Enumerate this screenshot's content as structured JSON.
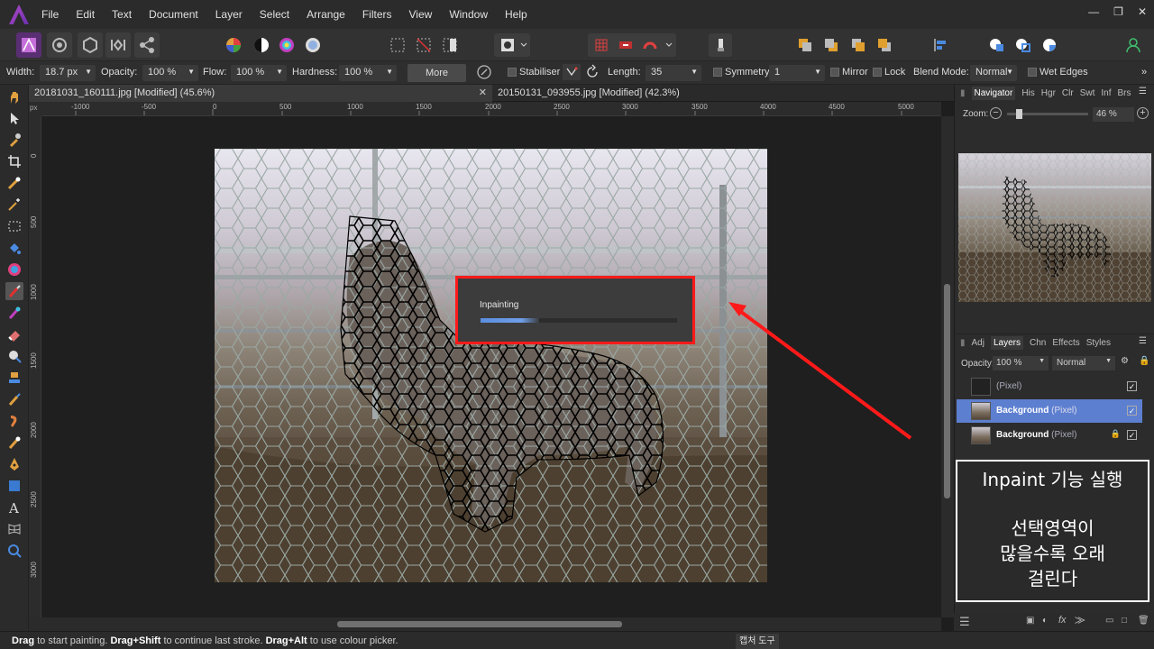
{
  "menu": [
    "File",
    "Edit",
    "Text",
    "Document",
    "Layer",
    "Select",
    "Arrange",
    "Filters",
    "View",
    "Window",
    "Help"
  ],
  "context_bar": {
    "width_label": "Width:",
    "width_value": "18.7 px",
    "opacity_label": "Opacity:",
    "opacity_value": "100 %",
    "flow_label": "Flow:",
    "flow_value": "100 %",
    "hardness_label": "Hardness:",
    "hardness_value": "100 %",
    "more_label": "More",
    "stabiliser_label": "Stabiliser",
    "length_label": "Length:",
    "length_value": "35",
    "symmetry_label": "Symmetry",
    "symmetry_value": "1",
    "mirror_label": "Mirror",
    "lock_label": "Lock",
    "blend_label": "Blend Mode:",
    "blend_value": "Normal",
    "wet_edges_label": "Wet Edges"
  },
  "tabs": [
    {
      "title": "20181031_160111.jpg [Modified] (45.6%)"
    },
    {
      "title": "20150131_093955.jpg [Modified] (42.3%)"
    }
  ],
  "ruler": {
    "unit": "px",
    "h_labels": [
      "-1000",
      "-500",
      "0",
      "500",
      "1000",
      "1500",
      "2000",
      "2500",
      "3000",
      "3500",
      "4000",
      "4500",
      "5000"
    ],
    "v_labels": [
      "0",
      "500",
      "1000",
      "1500",
      "2000",
      "2500",
      "3000"
    ]
  },
  "dialog": {
    "title": "Inpainting",
    "progress": 0.3
  },
  "status": {
    "drag": "Drag",
    "drag_text": " to start painting. ",
    "drag_shift": "Drag+Shift",
    "drag_shift_text": " to continue last stroke. ",
    "drag_alt": "Drag+Alt",
    "drag_alt_text": " to use colour picker.",
    "capture_label": "캡처 도구"
  },
  "navigator": {
    "tabs": [
      "Navigator",
      "His",
      "Hgr",
      "Clr",
      "Swt",
      "Inf",
      "Brs"
    ],
    "zoom_label": "Zoom:",
    "zoom_value": "46 %"
  },
  "layers_panel": {
    "tabs": [
      "Adj",
      "Layers",
      "Chn",
      "Effects",
      "Styles"
    ],
    "opacity_label": "Opacity:",
    "opacity_value": "100 %",
    "blend_value": "Normal",
    "layers": [
      {
        "name": "",
        "type": "(Pixel)",
        "selected": false,
        "locked": false
      },
      {
        "name": "Background",
        "type": "(Pixel)",
        "selected": true,
        "locked": false
      },
      {
        "name": "Background",
        "type": "(Pixel)",
        "selected": false,
        "locked": true
      }
    ]
  },
  "annotation": {
    "line1": "Inpaint 기능 실행",
    "line2": "선택영역이",
    "line3": "많을수록 오래",
    "line4": "걸린다"
  },
  "colors": {
    "accent": "#5d7fd0",
    "highlight": "#ff1a1a",
    "progress": "#5b8edf"
  }
}
